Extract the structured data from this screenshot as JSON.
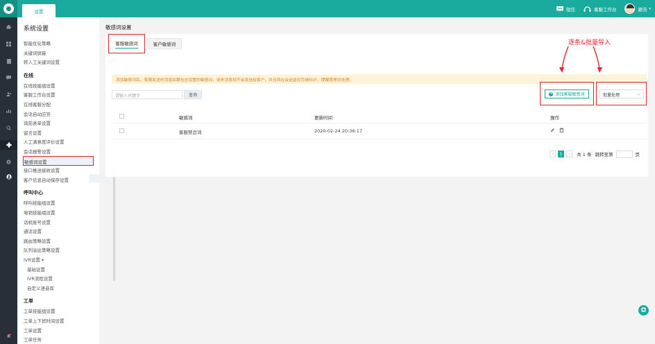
{
  "app": {
    "top_tab": "设置",
    "sms": "短信",
    "workbench": "客服工作台",
    "user": "颖浩"
  },
  "menu": {
    "title": "系统设置",
    "groups": [
      {
        "section": "",
        "items": [
          "智能优化策略",
          "关键词屏蔽",
          "转人工关键词设置"
        ]
      },
      {
        "section": "在线",
        "items": [
          "在线技能组设置",
          "客服工作台设置",
          "在线客服分配",
          "会话自动应答",
          "询前表单设置",
          "留言设置",
          "人工满意度评价设置",
          "会话报警设置",
          "敏感词设置",
          "接口推送接收设置",
          "客户信息自动保存设置"
        ]
      },
      {
        "section": "呼叫中心",
        "items": [
          "呼叫技能组设置",
          "电销技能组设置",
          "话机账号设置",
          "通话设置",
          "路由策略设置",
          "队列溢出策略设置",
          "IVR设置 ▾"
        ]
      },
      {
        "section": "",
        "sub": true,
        "items": [
          "基础设置",
          "IVR流程设置",
          "自定义语音库"
        ]
      },
      {
        "section": "工单",
        "items": [
          "工单技能组设置",
          "工单上下班时间设置",
          "工单设置",
          "工单任务"
        ]
      }
    ]
  },
  "main": {
    "breadcrumb": "敏感词设置",
    "tabs": [
      "客服敏感词",
      "客户敏感词"
    ],
    "notice": "添加敏感词后，客服发送的消息如果包含设置的敏感词，该条消息将不会发送给客户，并且将在会话监控页被标识，提醒管理员处理。",
    "search_placeholder": "请输入关键字",
    "search_button": "查询",
    "add_button": "添加客服敏感词",
    "batch_select": "批量处理",
    "annotation": "逐条&批量导入",
    "columns": [
      "敏感词",
      "更新时间",
      "操作"
    ],
    "rows": [
      {
        "word": "客服禁忌词",
        "updated": "2020-02-24 20:36:17"
      }
    ],
    "pager": {
      "current": "1",
      "total": "共 1 条",
      "jump": "跳转至第",
      "page": "页"
    }
  },
  "colors": {
    "accent": "#1aab9e",
    "highlight": "#e0262b",
    "rail": "#273039"
  }
}
